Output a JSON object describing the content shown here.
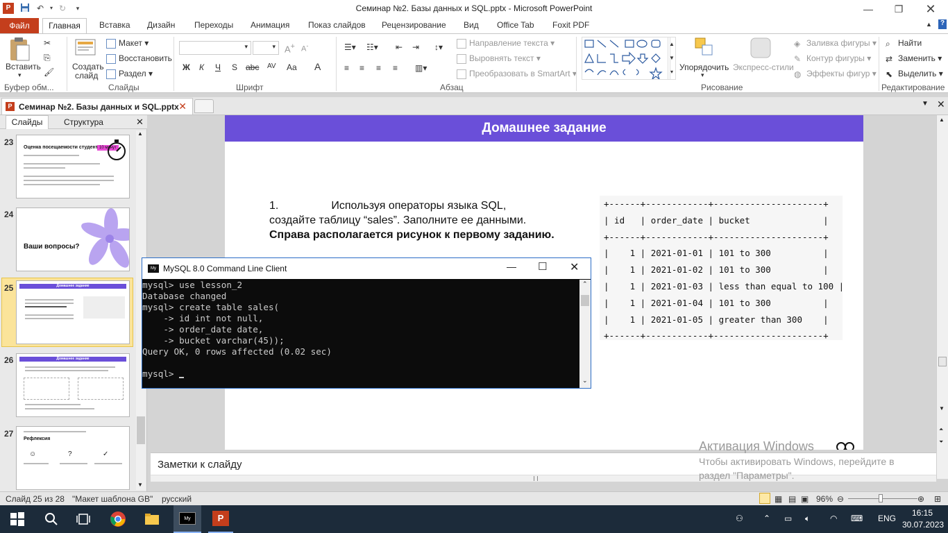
{
  "window": {
    "title": "Семинар №2. Базы данных и SQL.pptx  -  Microsoft PowerPoint"
  },
  "ribbon_tabs": {
    "file": "Файл",
    "items": [
      "Главная",
      "Вставка",
      "Дизайн",
      "Переходы",
      "Анимация",
      "Показ слайдов",
      "Рецензирование",
      "Вид",
      "Office Tab",
      "Foxit PDF"
    ]
  },
  "ribbon": {
    "clipboard": {
      "paste": "Вставить",
      "group": "Буфер обм..."
    },
    "slides": {
      "new_slide_1": "Создать",
      "new_slide_2": "слайд",
      "layout": "Макет",
      "reset": "Восстановить",
      "section": "Раздел",
      "group": "Слайды"
    },
    "font": {
      "group": "Шрифт",
      "bold": "Ж",
      "italic": "К",
      "underline": "Ч",
      "shadow": "S",
      "strike": "abc",
      "spacing": "AV",
      "case": "Aa",
      "color": "A"
    },
    "paragraph": {
      "text_direction": "Направление текста",
      "align_text": "Выровнять текст",
      "smartart": "Преобразовать в SmartArt",
      "group": "Абзац"
    },
    "drawing": {
      "arrange": "Упорядочить",
      "quick_styles": "Экспресс-стили",
      "fill": "Заливка фигуры",
      "outline": "Контур фигуры",
      "effects": "Эффекты фигур",
      "group": "Рисование"
    },
    "editing": {
      "find": "Найти",
      "replace": "Заменить",
      "select": "Выделить",
      "group": "Редактирование"
    }
  },
  "doc_tab": {
    "label": "Семинар №2. Базы данных и SQL.pptx"
  },
  "panel": {
    "tab_slides": "Слайды",
    "tab_outline": "Структура",
    "slides": [
      {
        "num": "23",
        "title": "Оценка посещаемости студента",
        "badge": "10 минут"
      },
      {
        "num": "24",
        "title": "Ваши вопросы?"
      },
      {
        "num": "25",
        "title": "Домашнее задание"
      },
      {
        "num": "26",
        "title": "Домашнее задание"
      },
      {
        "num": "27",
        "title": "Рефлексия"
      }
    ]
  },
  "slide": {
    "header": "Домашнее задание",
    "task_num": "1.",
    "task_line1": "Используя операторы языка SQL,",
    "task_line2": "создайте таблицу “sales”. Заполните ее данными.",
    "task_bold": "Справа располагается рисунок к первому заданию.",
    "table_text": "+------+------------+---------------------+\n| id   | order_date | bucket              |\n+------+------------+---------------------+\n|    1 | 2021-01-01 | 101 to 300          |\n|    1 | 2021-01-02 | 101 to 300          |\n|    1 | 2021-01-03 | less than equal to 100 |\n|    1 | 2021-01-04 | 101 to 300          |\n|    1 | 2021-01-05 | greater than 300    |\n+------+------------+---------------------+"
  },
  "notes": {
    "placeholder": "Заметки к слайду"
  },
  "watermark": {
    "title": "Активация Windows",
    "line1": "Чтобы активировать Windows, перейдите в",
    "line2": "раздел \"Параметры\"."
  },
  "console": {
    "title": "MySQL 8.0 Command Line Client",
    "text": "mysql> use lesson_2\nDatabase changed\nmysql> create table sales(\n    -> id int not null,\n    -> order_date date,\n    -> bucket varchar(45));\nQuery OK, 0 rows affected (0.02 sec)\n\nmysql> "
  },
  "status": {
    "slide_info": "Слайд 25 из 28",
    "theme": "\"Макет шаблона GB\"",
    "language": "русский",
    "zoom": "96%"
  },
  "taskbar": {
    "lang": "ENG",
    "time": "16:15",
    "date": "30.07.2023"
  },
  "colors": {
    "accent_purple": "#6a4fd9",
    "file_tab": "#c43e1c",
    "taskbar": "#1c2b3a"
  }
}
